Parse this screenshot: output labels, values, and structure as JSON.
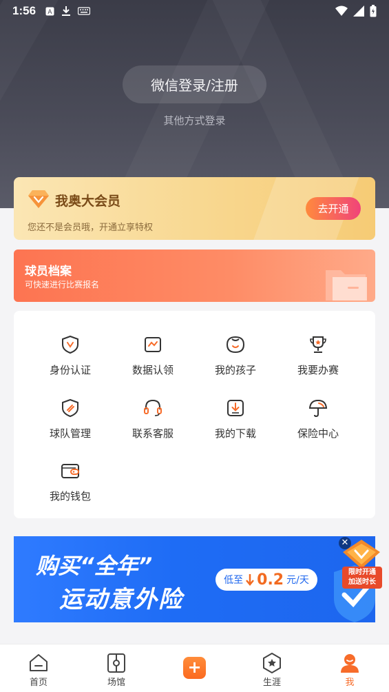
{
  "status_bar": {
    "time": "1:56"
  },
  "login": {
    "wechat_label": "微信登录/注册",
    "other_label": "其他方式登录"
  },
  "vip": {
    "title": "我奥大会员",
    "subtitle": "您还不是会员哦，开通立享特权",
    "open_label": "去开通"
  },
  "archive": {
    "title": "球员档案",
    "subtitle": "可快速进行比赛报名"
  },
  "grid": {
    "items": [
      {
        "label": "身份认证",
        "icon": "shield-v-icon"
      },
      {
        "label": "数据认领",
        "icon": "chart-card-icon"
      },
      {
        "label": "我的孩子",
        "icon": "child-face-icon"
      },
      {
        "label": "我要办赛",
        "icon": "trophy-icon"
      },
      {
        "label": "球队管理",
        "icon": "team-shield-icon"
      },
      {
        "label": "联系客服",
        "icon": "headset-icon"
      },
      {
        "label": "我的下载",
        "icon": "download-icon"
      },
      {
        "label": "保险中心",
        "icon": "umbrella-icon"
      },
      {
        "label": "我的钱包",
        "icon": "wallet-icon"
      }
    ]
  },
  "banner": {
    "line1_a": "购买",
    "line1_b": "“全年”",
    "line2": "运动意外险",
    "price_prefix": "低至",
    "price_value": "0.2",
    "price_unit": "元/天"
  },
  "promo": {
    "line1": "限时开通",
    "line2": "加送时长",
    "close": "✕"
  },
  "tabbar": {
    "items": [
      {
        "label": "首页",
        "icon": "home-icon"
      },
      {
        "label": "场馆",
        "icon": "venue-icon"
      },
      {
        "label": "生涯",
        "icon": "career-badge-icon"
      },
      {
        "label": "我",
        "icon": "profile-icon"
      }
    ],
    "plus": "+"
  },
  "colors": {
    "accent": "#f76c2a",
    "header_bg": "#3f404c",
    "vip_gold": "#f8d78f",
    "archive_orange": "#fd7451",
    "banner_blue": "#1e6cf5"
  }
}
